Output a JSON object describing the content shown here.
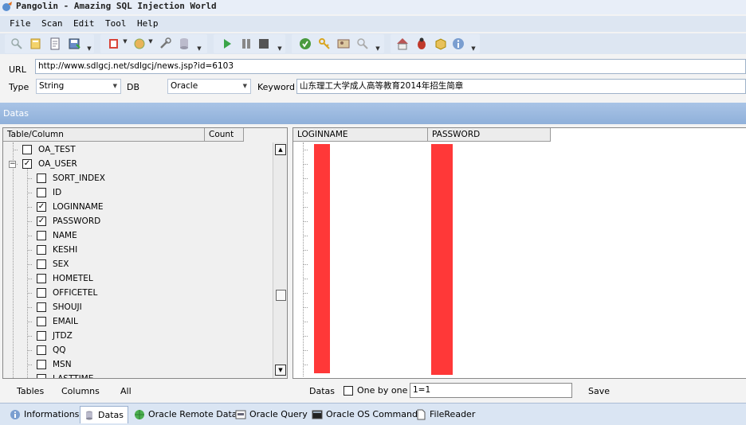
{
  "window": {
    "title": "Pangolin - Amazing SQL Injection World"
  },
  "menu": {
    "items": [
      "File",
      "Scan",
      "Edit",
      "Tool",
      "Help"
    ]
  },
  "form": {
    "url_label": "URL",
    "url_value": "http://www.sdlgcj.net/sdlgcj/news.jsp?id=6103",
    "type_label": "Type",
    "type_value": "String",
    "db_label": "DB",
    "db_value": "Oracle",
    "keyword_label": "Keyword",
    "keyword_value": "山东理工大学成人高等教育2014年招生简章"
  },
  "datas_header": "Datas",
  "tree": {
    "col_table": "Table/Column",
    "col_count": "Count",
    "rows": [
      {
        "label": "OA_TEST",
        "checked": false,
        "level": 1
      },
      {
        "label": "OA_USER",
        "checked": true,
        "level": 1,
        "expanded": true
      },
      {
        "label": "SORT_INDEX",
        "checked": false,
        "level": 2
      },
      {
        "label": "ID",
        "checked": false,
        "level": 2
      },
      {
        "label": "LOGINNAME",
        "checked": true,
        "level": 2
      },
      {
        "label": "PASSWORD",
        "checked": true,
        "level": 2
      },
      {
        "label": "NAME",
        "checked": false,
        "level": 2
      },
      {
        "label": "KESHI",
        "checked": false,
        "level": 2
      },
      {
        "label": "SEX",
        "checked": false,
        "level": 2
      },
      {
        "label": "HOMETEL",
        "checked": false,
        "level": 2
      },
      {
        "label": "OFFICETEL",
        "checked": false,
        "level": 2
      },
      {
        "label": "SHOUJI",
        "checked": false,
        "level": 2
      },
      {
        "label": "EMAIL",
        "checked": false,
        "level": 2
      },
      {
        "label": "JTDZ",
        "checked": false,
        "level": 2
      },
      {
        "label": "QQ",
        "checked": false,
        "level": 2
      },
      {
        "label": "MSN",
        "checked": false,
        "level": 2
      },
      {
        "label": "LASTTIME",
        "checked": false,
        "level": 2
      }
    ]
  },
  "grid": {
    "col_login": "LOGINNAME",
    "col_password": "PASSWORD"
  },
  "left_buttons": {
    "tables": "Tables",
    "columns": "Columns",
    "all": "All"
  },
  "right_controls": {
    "datas": "Datas",
    "one_by_one": "One by one",
    "condition": "1=1",
    "save": "Save"
  },
  "tabs": [
    "Informations",
    "Datas",
    "Oracle Remote Data",
    "Oracle Query",
    "Oracle OS Command",
    "FileReader"
  ],
  "colors": {
    "accent": "#8fb0da",
    "redaction": "#ff3838"
  }
}
